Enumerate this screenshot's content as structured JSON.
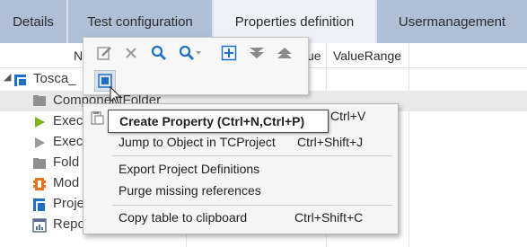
{
  "tabs": [
    {
      "label": "Details",
      "state": "inactive"
    },
    {
      "label": "Test configuration",
      "state": "inactive"
    },
    {
      "label": "Properties definition",
      "state": "active"
    },
    {
      "label": "Usermanagement",
      "state": "inactive"
    }
  ],
  "columns": {
    "name_partial": "N",
    "value_partial": "ue",
    "value_range": "ValueRange"
  },
  "tree": {
    "root": "Tosca_",
    "items": [
      {
        "label": "ComponentFolder",
        "icon": "folder-icon"
      },
      {
        "label": "Exec",
        "icon": "execution-icon"
      },
      {
        "label": "Exec",
        "icon": "execution-list-icon"
      },
      {
        "label": "Fold",
        "icon": "folder-icon"
      },
      {
        "label": "Mod",
        "icon": "module-icon"
      },
      {
        "label": "Proje",
        "icon": "project-icon"
      },
      {
        "label": "ReportDefinition",
        "icon": "report-icon"
      }
    ]
  },
  "toolbar": {
    "icons": [
      "edit-icon",
      "delete-icon",
      "search-icon",
      "search-dropdown-icon",
      "add-icon",
      "expand-all-icon",
      "collapse-all-icon",
      "create-property-icon"
    ]
  },
  "menu": {
    "items": [
      {
        "label": "Create Property (Ctrl+N,Ctrl+P)",
        "shortcut": "Ctrl+V"
      },
      {
        "label": "Jump to Object in TCProject",
        "shortcut": "Ctrl+Shift+J"
      },
      {
        "label": "Export Project Definitions",
        "shortcut": ""
      },
      {
        "label": "Purge missing references",
        "shortcut": ""
      },
      {
        "label": "Copy table to clipboard",
        "shortcut": "Ctrl+Shift+C"
      }
    ]
  },
  "tooltip": "Create Property (Ctrl+N,Ctrl+P)",
  "colors": {
    "tab_inactive": "#aebfd6",
    "tab_active": "#eef2f7",
    "icon_blue": "#1e6fc6"
  }
}
